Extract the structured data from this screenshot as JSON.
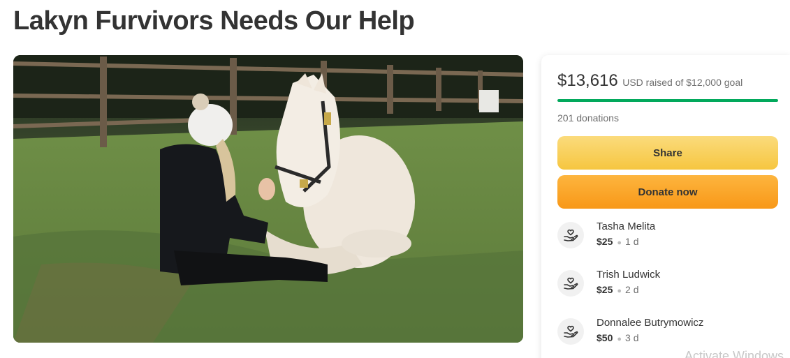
{
  "page": {
    "title": "Lakyn Furvivors Needs Our Help"
  },
  "photo": {
    "alt_subject": "woman-sitting-with-white-horse"
  },
  "donation_card": {
    "raised_amount": "$13,616",
    "raised_text": "USD raised of $12,000 goal",
    "progress_fraction": 1.0,
    "donation_count": "201 donations",
    "share_label": "Share",
    "donate_label": "Donate now",
    "accent_color": "#02a95c"
  },
  "donors": [
    {
      "name": "Tasha Melita",
      "amount": "$25",
      "time": "1 d",
      "icon": "donation-heart-hand-icon"
    },
    {
      "name": "Trish Ludwick",
      "amount": "$25",
      "time": "2 d",
      "icon": "donation-heart-hand-icon"
    },
    {
      "name": "Donnalee Butrymowicz",
      "amount": "$50",
      "time": "3 d",
      "icon": "donation-heart-hand-icon"
    }
  ],
  "watermark": "Activate Windows"
}
